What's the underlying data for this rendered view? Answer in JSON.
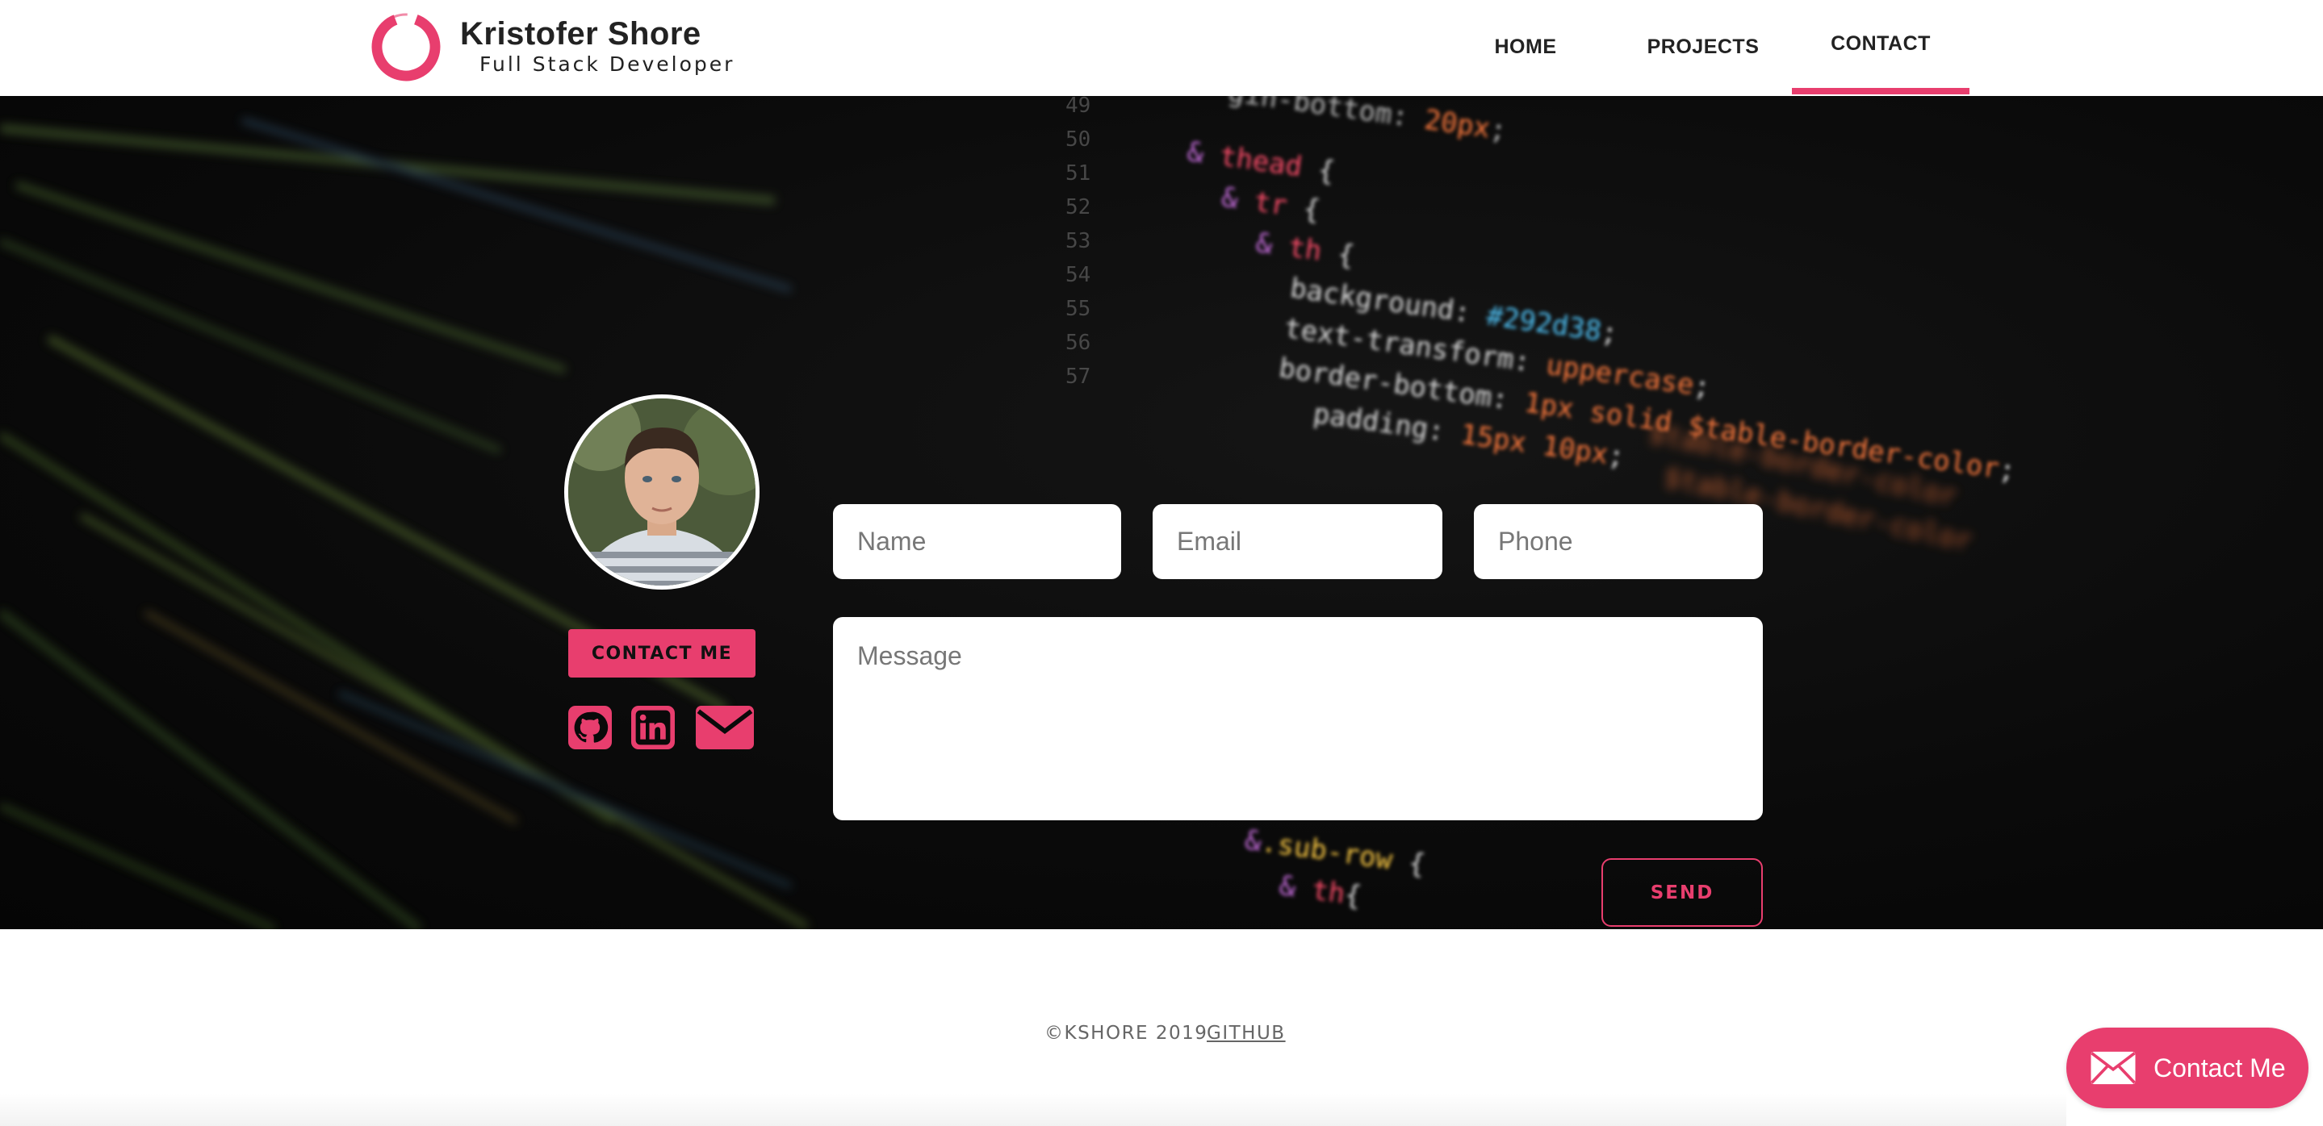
{
  "header": {
    "brand_name": "Kristofer Shore",
    "brand_subtitle": "Full Stack Developer",
    "nav": [
      {
        "label": "HOME",
        "active": false
      },
      {
        "label": "PROJECTS",
        "active": false
      },
      {
        "label": "CONTACT",
        "active": true
      }
    ]
  },
  "sidebar": {
    "contact_button": "CONTACT ME",
    "social_icons": [
      "github-icon",
      "linkedin-icon",
      "envelope-icon"
    ]
  },
  "form": {
    "name_placeholder": "Name",
    "email_placeholder": "Email",
    "phone_placeholder": "Phone",
    "message_placeholder": "Message",
    "send_label": "SEND"
  },
  "footer": {
    "copyright": "©KSHORE 2019",
    "github_link": "GITHUB"
  },
  "floating_button": {
    "label": "Contact Me",
    "icon": "envelope-icon"
  },
  "colors": {
    "accent": "#e83e6e",
    "background_dark": "#0a0a0a",
    "text_dark": "#222222"
  }
}
